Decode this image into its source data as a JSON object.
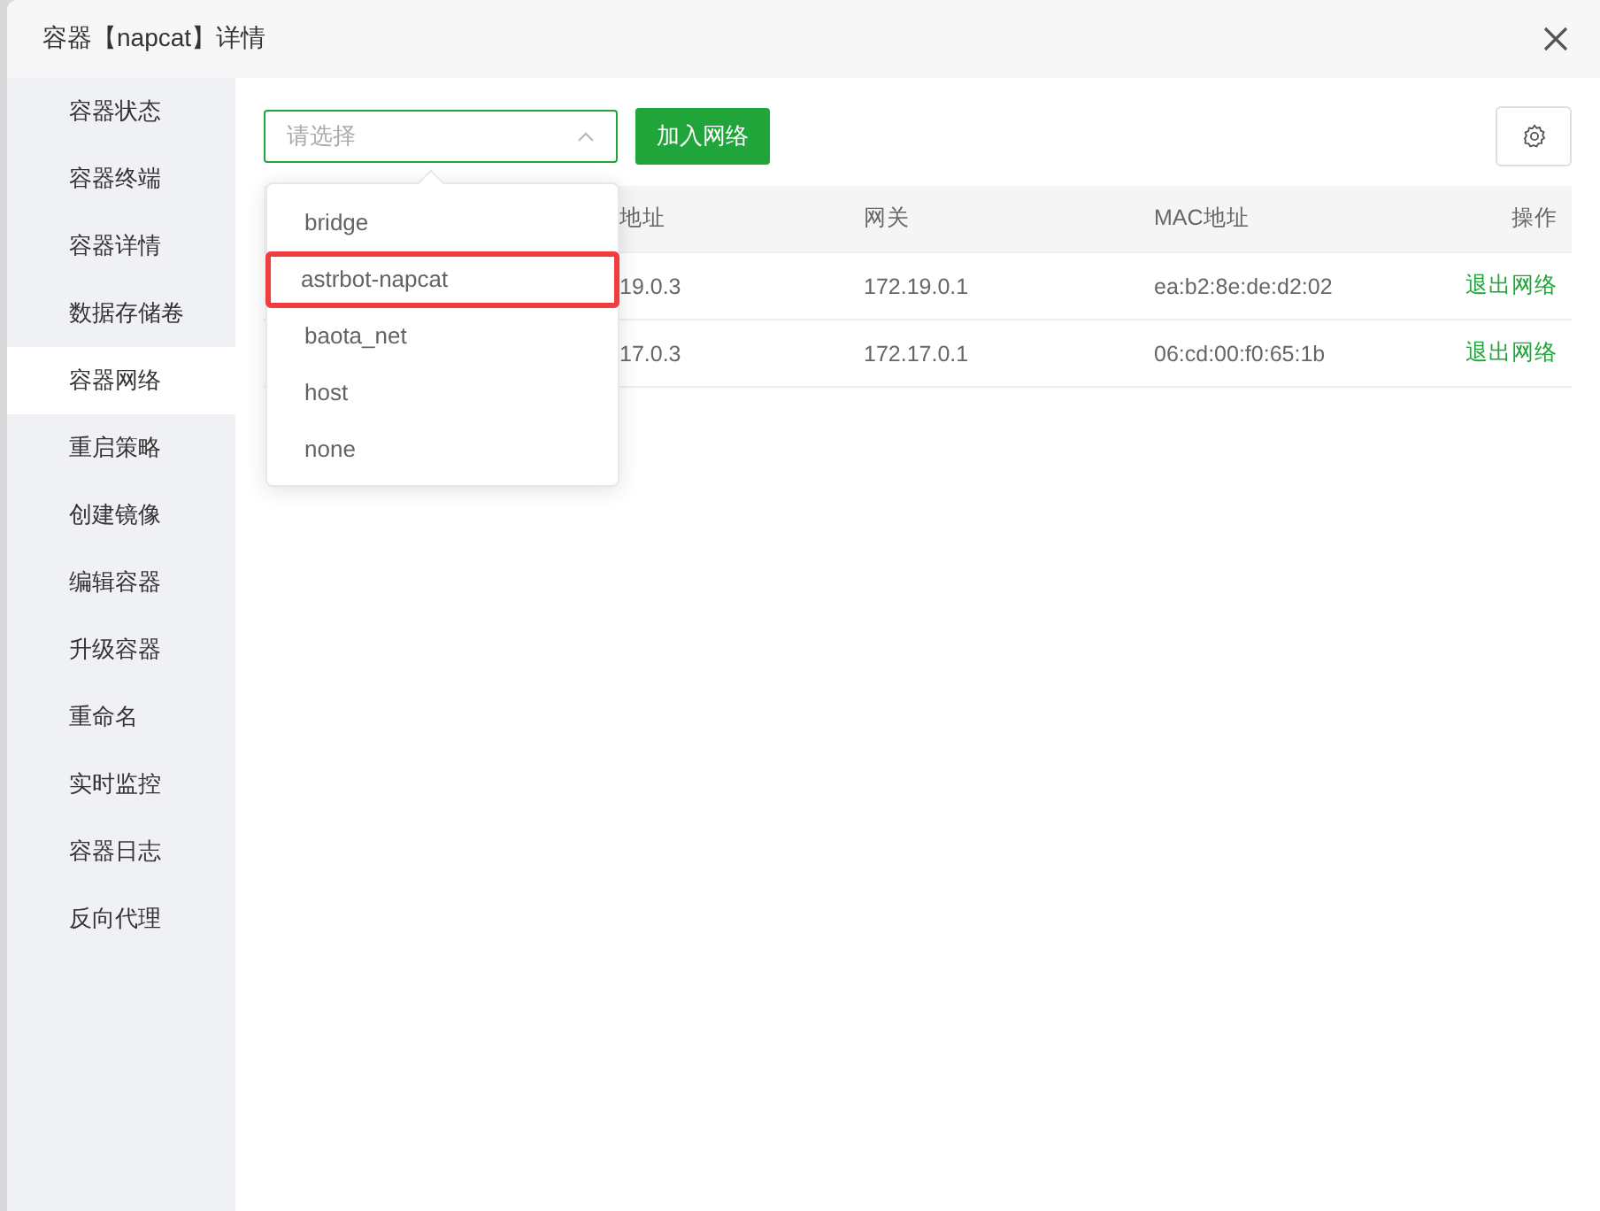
{
  "window": {
    "title": "容器【napcat】详情"
  },
  "sidebar": {
    "items": [
      {
        "label": "容器状态",
        "selected": false
      },
      {
        "label": "容器终端",
        "selected": false
      },
      {
        "label": "容器详情",
        "selected": false
      },
      {
        "label": "数据存储卷",
        "selected": false
      },
      {
        "label": "容器网络",
        "selected": true
      },
      {
        "label": "重启策略",
        "selected": false
      },
      {
        "label": "创建镜像",
        "selected": false
      },
      {
        "label": "编辑容器",
        "selected": false
      },
      {
        "label": "升级容器",
        "selected": false
      },
      {
        "label": "重命名",
        "selected": false
      },
      {
        "label": "实时监控",
        "selected": false
      },
      {
        "label": "容器日志",
        "selected": false
      },
      {
        "label": "反向代理",
        "selected": false
      }
    ]
  },
  "toolbar": {
    "select": {
      "placeholder": "请选择",
      "expanded": true
    },
    "add_button": "加入网络"
  },
  "dropdown": {
    "options": [
      {
        "label": "bridge",
        "highlighted": false
      },
      {
        "label": "astrbot-napcat",
        "highlighted": true
      },
      {
        "label": "baota_net",
        "highlighted": false
      },
      {
        "label": "host",
        "highlighted": false
      },
      {
        "label": "none",
        "highlighted": false
      }
    ]
  },
  "table": {
    "columns": [
      "地址",
      "网关",
      "MAC地址",
      "操作"
    ],
    "rows": [
      {
        "cells": [
          "19.0.3",
          "172.19.0.1",
          "ea:b2:8e:de:d2:02"
        ],
        "action": "退出网络"
      },
      {
        "cells": [
          "17.0.3",
          "172.17.0.1",
          "06:cd:00:f0:65:1b"
        ],
        "action": "退出网络"
      }
    ]
  }
}
